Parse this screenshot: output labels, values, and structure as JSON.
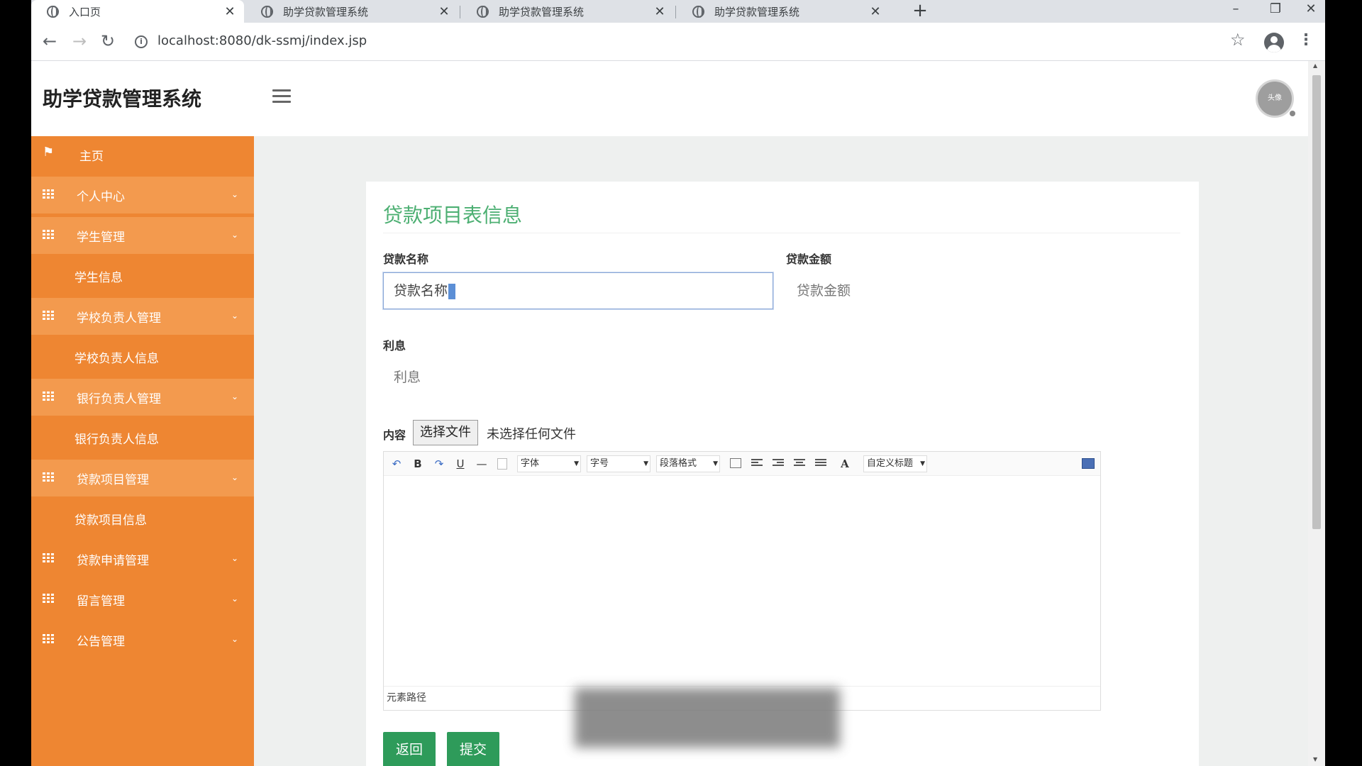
{
  "browser": {
    "tabs": [
      {
        "title": "入口页",
        "active": true
      },
      {
        "title": "助学贷款管理系统",
        "active": false
      },
      {
        "title": "助学贷款管理系统",
        "active": false
      },
      {
        "title": "助学贷款管理系统",
        "active": false
      }
    ],
    "close_glyph": "✕",
    "new_tab_glyph": "+",
    "url": "localhost:8080/dk-ssmj/index.jsp",
    "window_controls": {
      "minimize": "–",
      "restore": "❐",
      "close": "✕"
    },
    "nav": {
      "back": "←",
      "forward": "→",
      "reload": "↻",
      "info": "i",
      "star": "☆",
      "menu": "⋮"
    }
  },
  "app": {
    "brand": "助学贷款管理系统",
    "avatar_text": "头像"
  },
  "sidebar": {
    "items": [
      {
        "label": "主页",
        "type": "top",
        "icon": "flag-icon"
      },
      {
        "label": "个人中心",
        "type": "group",
        "icon": "grid-icon"
      },
      {
        "label": "学生管理",
        "type": "group",
        "icon": "grid-icon"
      },
      {
        "label": "学生信息",
        "type": "sub"
      },
      {
        "label": "学校负责人管理",
        "type": "group",
        "icon": "grid-icon"
      },
      {
        "label": "学校负责人信息",
        "type": "sub"
      },
      {
        "label": "银行负责人管理",
        "type": "group",
        "icon": "grid-icon"
      },
      {
        "label": "银行负责人信息",
        "type": "sub"
      },
      {
        "label": "贷款项目管理",
        "type": "group",
        "icon": "grid-icon"
      },
      {
        "label": "贷款项目信息",
        "type": "sub"
      },
      {
        "label": "贷款申请管理",
        "type": "group",
        "icon": "grid-icon"
      },
      {
        "label": "留言管理",
        "type": "group",
        "icon": "grid-icon"
      },
      {
        "label": "公告管理",
        "type": "group",
        "icon": "grid-icon"
      }
    ],
    "caret": "⌄"
  },
  "form": {
    "title": "贷款项目表信息",
    "loan_name": {
      "label": "贷款名称",
      "value": "贷款名称"
    },
    "loan_amount": {
      "label": "贷款金额",
      "placeholder": "贷款金额"
    },
    "interest": {
      "label": "利息",
      "placeholder": "利息"
    },
    "content": {
      "label": "内容",
      "file_button": "选择文件",
      "file_status": "未选择任何文件"
    },
    "editor": {
      "toolbar": {
        "undo": "↶",
        "bold": "B",
        "redo": "↷",
        "underline": "U",
        "hr": "—",
        "font_family": "字体",
        "font_size": "字号",
        "paragraph": "段落格式",
        "font_color": "A",
        "custom_title": "自定义标题"
      },
      "footer": "元素路径"
    },
    "back_button": "返回",
    "submit_button": "提交"
  },
  "colors": {
    "sidebar": "#ee8632",
    "sidebar_group": "#f39a4e",
    "title_green": "#4caf72",
    "button_green": "#2e9b5a"
  }
}
